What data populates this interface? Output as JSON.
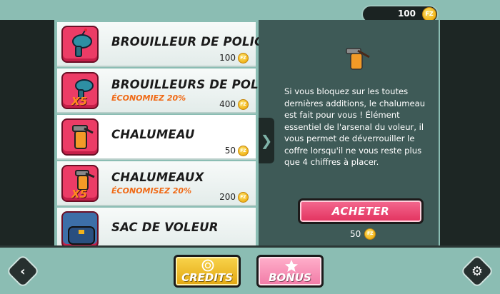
{
  "balance": {
    "amount": "100",
    "coin_label": "FZ"
  },
  "items": [
    {
      "title": "BROUILLEUR DE POLICE",
      "subtitle": "",
      "price": "100",
      "badge": ""
    },
    {
      "title": "BROUILLEURS DE POLICE",
      "subtitle": "ÉCONOMIEZ 20%",
      "price": "400",
      "badge": "X5"
    },
    {
      "title": "CHALUMEAU",
      "subtitle": "",
      "price": "50",
      "badge": ""
    },
    {
      "title": "CHALUMEAUX",
      "subtitle": "ÉCONOMISEZ 20%",
      "price": "200",
      "badge": "X5"
    },
    {
      "title": "SAC DE VOLEUR",
      "subtitle": "",
      "price": "",
      "badge": ""
    }
  ],
  "selected_index": 2,
  "detail": {
    "description": "Si vous bloquez sur les toutes dernières additions, le chalumeau est fait pour vous ! Élément essentiel de l'arsenal du voleur, il vous permet de déverrouiller le coffre lorsqu'il ne vous reste plus que 4 chiffres à placer.",
    "buy_label": "ACHETER",
    "price": "50"
  },
  "bottom": {
    "credits_label": "CREDITS",
    "bonus_label": "BONUS"
  },
  "icons": {
    "back": "chevron-left-icon",
    "settings": "gear-icon",
    "coin": "coin-icon",
    "expand": "chevron-right-icon"
  },
  "colors": {
    "background": "#8bbdb3",
    "accent_pink": "#ec3c66",
    "accent_orange": "#f06a16",
    "credits_yellow": "#f9d44c",
    "detail_panel": "#3e5a57"
  }
}
